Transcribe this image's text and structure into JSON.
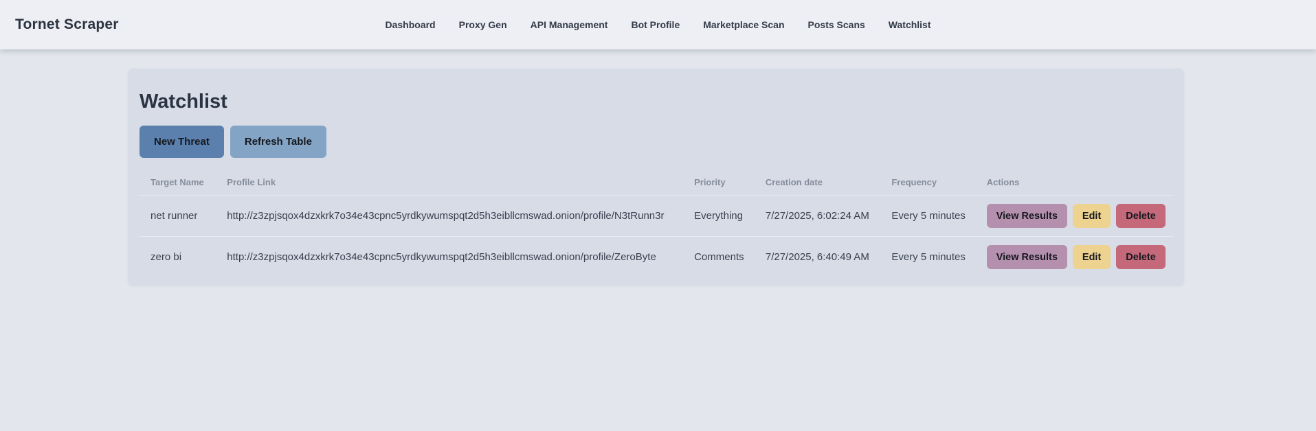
{
  "app": {
    "title": "Tornet Scraper"
  },
  "nav": {
    "items": [
      {
        "label": "Dashboard"
      },
      {
        "label": "Proxy Gen"
      },
      {
        "label": "API Management"
      },
      {
        "label": "Bot Profile"
      },
      {
        "label": "Marketplace Scan"
      },
      {
        "label": "Posts Scans"
      },
      {
        "label": "Watchlist"
      }
    ]
  },
  "page": {
    "title": "Watchlist",
    "new_threat_label": "New Threat",
    "refresh_table_label": "Refresh Table"
  },
  "table": {
    "columns": {
      "target_name": "Target Name",
      "profile_link": "Profile Link",
      "priority": "Priority",
      "creation_date": "Creation date",
      "frequency": "Frequency",
      "actions": "Actions"
    },
    "action_labels": {
      "view_results": "View Results",
      "edit": "Edit",
      "delete": "Delete"
    },
    "rows": [
      {
        "target_name": "net runner",
        "profile_link": "http://z3zpjsqox4dzxkrk7o34e43cpnc5yrdkywumspqt2d5h3eibllcmswad.onion/profile/N3tRunn3r",
        "priority": "Everything",
        "creation_date": "7/27/2025, 6:02:24 AM",
        "frequency": "Every 5 minutes"
      },
      {
        "target_name": "zero bi",
        "profile_link": "http://z3zpjsqox4dzxkrk7o34e43cpnc5yrdkywumspqt2d5h3eibllcmswad.onion/profile/ZeroByte",
        "priority": "Comments",
        "creation_date": "7/27/2025, 6:40:49 AM",
        "frequency": "Every 5 minutes"
      }
    ]
  },
  "colors": {
    "header_bg": "#edeff4",
    "page_bg": "#e3e6ec",
    "card_bg": "#d7dce7",
    "primary_button": "#5b80ae",
    "secondary_button": "#84a4c5",
    "view_results_button": "#b48fae",
    "edit_button": "#eed28f",
    "delete_button": "#c4687a",
    "heading_text": "#2b3442",
    "body_text": "#39404e",
    "column_header_text": "#858d9b"
  }
}
